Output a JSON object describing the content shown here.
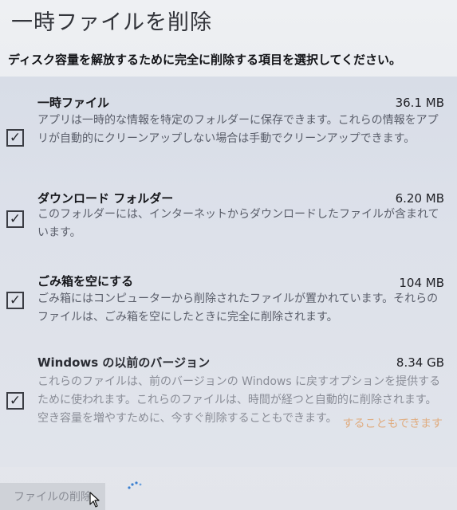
{
  "window": {
    "title": "一時ファイルを削除"
  },
  "instruction": "ディスク容量を解放するために完全に削除する項目を選択してください。",
  "items": [
    {
      "name": "一時ファイル",
      "size": "36.1 MB",
      "checked": true,
      "description": "アプリは一時的な情報を特定のフォルダーに保存できます。これらの情報をアプリが自動的にクリーンアップしない場合は手動でクリーンアップできます。"
    },
    {
      "name": "ダウンロード フォルダー",
      "size": "6.20 MB",
      "checked": true,
      "description": "このフォルダーには、インターネットからダウンロードしたファイルが含まれています。"
    },
    {
      "name": "ごみ箱を空にする",
      "size": "104 MB",
      "checked": true,
      "description": "ごみ箱にはコンピューターから削除されたファイルが置かれています。それらのファイルは、ごみ箱を空にしたときに完全に削除されます。"
    },
    {
      "name": "Windows の以前のバージョン",
      "size": "8.34 GB",
      "checked": true,
      "description": "これらのファイルは、前のバージョンの Windows に戻すオプションを提供するために使われます。これらのファイルは、時間が経つと自動的に削除されます。空き容量を増やすために、今すぐ削除することもできます。"
    }
  ],
  "checkbox_glyph": "✓",
  "watermark": "することもできます",
  "buttons": {
    "delete_label": "ファイルの削除"
  },
  "icons": {
    "cursor": "mouse-pointer-icon",
    "spinner": "loading-spinner-icon"
  },
  "colors": {
    "background": "#e9ebef",
    "list_background": "#dbe0e9",
    "button_background": "#cfd2d8",
    "button_text_disabled": "#8a8d96"
  }
}
